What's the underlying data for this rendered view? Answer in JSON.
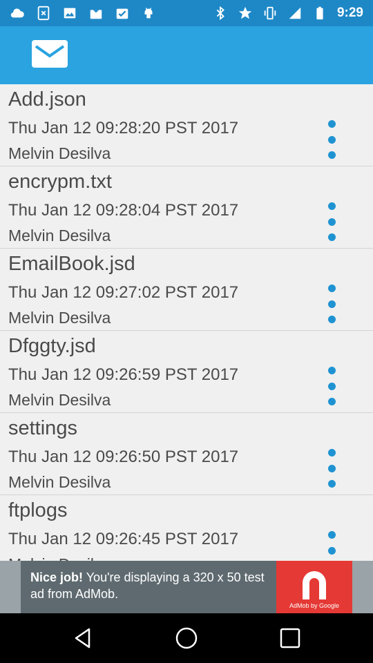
{
  "status_bar": {
    "time": "9:29",
    "left_icons": [
      "cloud-icon",
      "close-box-icon",
      "photo-icon",
      "mail-download-icon",
      "check-box-icon",
      "android-icon"
    ],
    "right_icons": [
      "bluetooth-icon",
      "star-icon",
      "vibrate-icon",
      "signal-icon",
      "battery-icon"
    ]
  },
  "app_bar": {
    "icon": "mail-icon",
    "color": "#2aa3e0"
  },
  "files": [
    {
      "name": "Add.json",
      "date": "Thu Jan 12 09:28:20 PST 2017",
      "author": "Melvin Desilva"
    },
    {
      "name": "encrypm.txt",
      "date": "Thu Jan 12 09:28:04 PST 2017",
      "author": "Melvin Desilva"
    },
    {
      "name": "EmailBook.jsd",
      "date": "Thu Jan 12 09:27:02 PST 2017",
      "author": "Melvin Desilva"
    },
    {
      "name": "Dfggty.jsd",
      "date": "Thu Jan 12 09:26:59 PST 2017",
      "author": "Melvin Desilva"
    },
    {
      "name": "settings",
      "date": "Thu Jan 12 09:26:50 PST 2017",
      "author": "Melvin Desilva"
    },
    {
      "name": "ftplogs",
      "date": "Thu Jan 12 09:26:45 PST 2017",
      "author": "Melvin Desilva"
    }
  ],
  "ad": {
    "headline": "Nice job!",
    "body": "You're displaying a 320 x 50 test ad from AdMob.",
    "badge": "AdMob by Google"
  },
  "nav_bar": {
    "icons": [
      "back-icon",
      "home-icon",
      "recents-icon"
    ]
  }
}
